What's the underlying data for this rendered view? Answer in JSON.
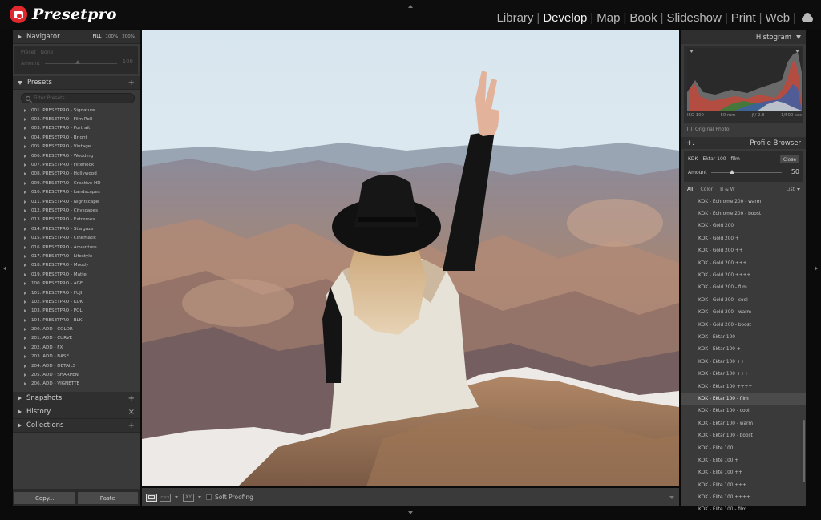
{
  "brand": {
    "name": "Presetpro"
  },
  "modules": [
    "Library",
    "Develop",
    "Map",
    "Book",
    "Slideshow",
    "Print",
    "Web"
  ],
  "navigator": {
    "title": "Navigator",
    "zoom_options": [
      "FILL",
      "100%",
      "200%"
    ],
    "preset_label": "Preset : None",
    "amount_label": "Amount",
    "amount_value": "100"
  },
  "presets": {
    "title": "Presets",
    "filter_placeholder": "Filter Presets",
    "items": [
      "001. PRESETPRO - Signature",
      "002. PRESETPRO - Film Roll",
      "003. PRESETPRO - Portrait",
      "004. PRESETPRO - Bright",
      "005. PRESETPRO - Vintage",
      "006. PRESETPRO - Wedding",
      "007. PRESETPRO - Filterlook",
      "008. PRESETPRO - Hollywood",
      "009. PRESETPRO - Creative HD",
      "010. PRESETPRO - Landscapes",
      "011. PRESETPRO - Nightscape",
      "012. PRESETPRO - Cityscapes",
      "013. PRESETPRO - Extremes",
      "014. PRESETPRO - Stargaze",
      "015. PRESETPRO - Cinematic",
      "016. PRESETPRO - Adventure",
      "017. PRESETPRO - Lifestyle",
      "018. PRESETPRO - Moody",
      "019. PRESETPRO - Matte",
      "100. PRESETPRO - AGF",
      "101. PRESETPRO - FUJI",
      "102. PRESETPRO - KDK",
      "103. PRESETPRO - POL",
      "104. PRESETPRO - BLK",
      "200. ADD - COLOR",
      "201. ADD - CURVE",
      "202. ADD - FX",
      "203. ADD - BASE",
      "204. ADD - DETAILS",
      "205. ADD - SHARPEN",
      "206. ADD - VIGNETTE"
    ]
  },
  "sections": {
    "snapshots": "Snapshots",
    "history": "History",
    "collections": "Collections"
  },
  "buttons": {
    "copy": "Copy...",
    "paste": "Paste"
  },
  "toolbar": {
    "soft_proofing": "Soft Proofing",
    "xy": "XY"
  },
  "histogram": {
    "title": "Histogram",
    "iso": "ISO 100",
    "focal": "50 mm",
    "aperture": "ƒ / 2.8",
    "shutter": "1/500 sec",
    "original_photo": "Original Photo"
  },
  "profile_browser": {
    "title": "Profile Browser",
    "current": "KDK - Ektar 100 - film",
    "close": "Close",
    "amount_label": "Amount",
    "amount_value": "50",
    "tabs": [
      "All",
      "Color",
      "B & W"
    ],
    "list_toggle": "List",
    "selected": "KDK - Ektar 100 - film",
    "items": [
      "KDK - Echrome 200 - warm",
      "KDK - Echrome 200 - boost",
      "KDK - Gold 200",
      "KDK - Gold 200 +",
      "KDK - Gold 200 ++",
      "KDK - Gold 200 +++",
      "KDK - Gold 200 ++++",
      "KDK - Gold 200 - film",
      "KDK - Gold 200 - cool",
      "KDK - Gold 200 - warm",
      "KDK - Gold 200 - boost",
      "KDK - Ektar 100",
      "KDK - Ektar 100 +",
      "KDK - Ektar 100 ++",
      "KDK - Ektar 100 +++",
      "KDK - Ektar 100 ++++",
      "KDK - Ektar 100 - film",
      "KDK - Ektar 100 - cool",
      "KDK - Ektar 100 - warm",
      "KDK - Ektar 100 - boost",
      "KDK - Elite 100",
      "KDK - Elite 100 +",
      "KDK - Elite 100 ++",
      "KDK - Elite 100 +++",
      "KDK - Elite 100 ++++",
      "KDK - Elite 100 - film"
    ]
  },
  "colors": {
    "accent": "#e1282e",
    "panel": "#3a3a3a",
    "background": "#0b0b0b"
  }
}
